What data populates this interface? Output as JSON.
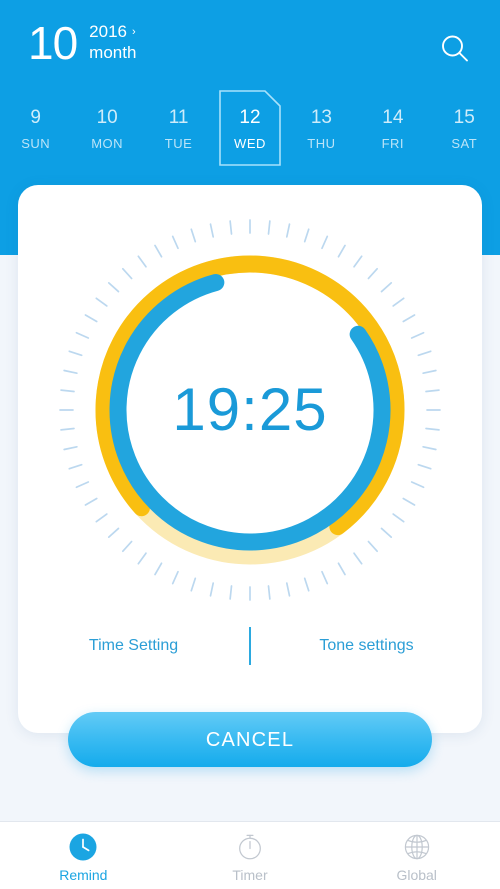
{
  "colors": {
    "header_blue": "#0d9fe4",
    "page_bg": "#f2f6fb",
    "card_white": "#ffffff",
    "accent_blue": "#1ba5e2",
    "arc_blue": "#22a5de",
    "arc_yellow": "#f9bf11",
    "arc_yellow_pale": "#fbeab4",
    "arc_overlap_teal": "#4fa39d",
    "tick_blue": "#bcd8ef",
    "link_blue": "#2b9ed6",
    "tab_inactive": "#b9c0c9",
    "cancel_top": "#63cbf6",
    "cancel_bottom": "#14abec"
  },
  "header": {
    "month_number": "10",
    "year": "2016",
    "year_caret": "›",
    "month_word": "month",
    "search_icon": "search-icon"
  },
  "dates": [
    {
      "num": "9",
      "dow": "SUN",
      "selected": false
    },
    {
      "num": "10",
      "dow": "MON",
      "selected": false
    },
    {
      "num": "11",
      "dow": "TUE",
      "selected": false
    },
    {
      "num": "12",
      "dow": "WED",
      "selected": true
    },
    {
      "num": "13",
      "dow": "THU",
      "selected": false
    },
    {
      "num": "14",
      "dow": "FRI",
      "selected": false
    },
    {
      "num": "15",
      "dow": "SAT",
      "selected": false
    }
  ],
  "dial": {
    "time": "19:25",
    "tick_count": 60,
    "yellow_arc_start_deg": 228,
    "yellow_arc_sweep_deg": 275,
    "blue_arc_start_deg": 55,
    "blue_arc_sweep_deg": 290
  },
  "links": {
    "time_setting": "Time Setting",
    "tone_settings": "Tone settings"
  },
  "cancel": {
    "label": "CANCEL"
  },
  "tabs": [
    {
      "label": "Remind",
      "icon": "clock-filled-icon",
      "active": true
    },
    {
      "label": "Timer",
      "icon": "stopwatch-icon",
      "active": false
    },
    {
      "label": "Global",
      "icon": "globe-icon",
      "active": false
    }
  ]
}
